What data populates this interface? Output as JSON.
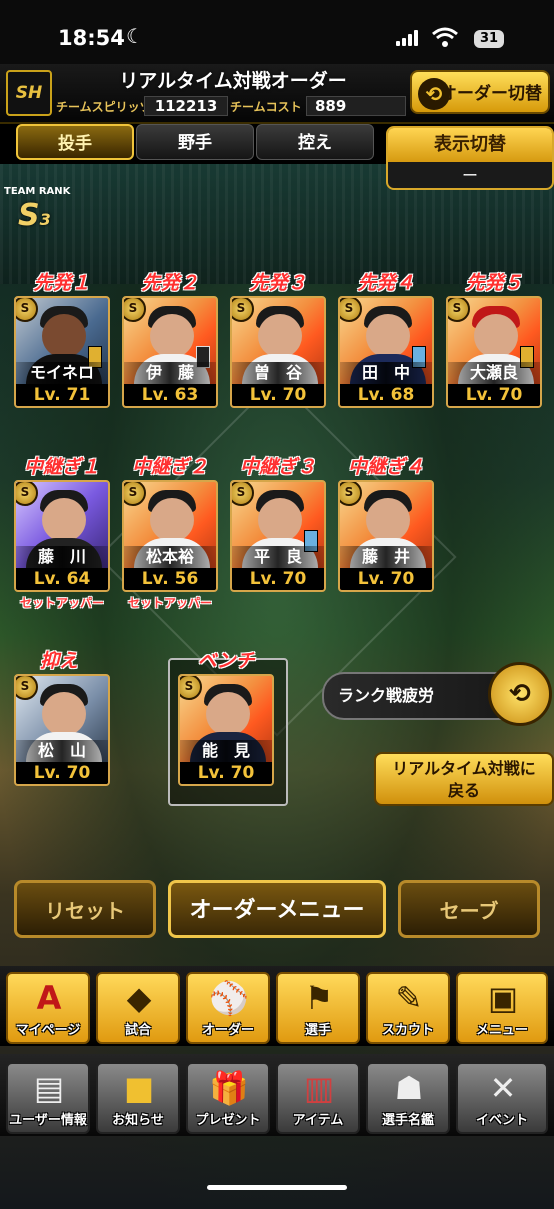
{
  "status": {
    "time": "18:54",
    "moon": "☾",
    "battery": "31"
  },
  "header": {
    "logo": "SH",
    "title": "リアルタイム対戦オーダー",
    "spirits_label": "チームスピリッツ",
    "spirits_value": "112213",
    "cost_label": "チームコスト",
    "cost_value": "889",
    "order_switch": "オーダー切替"
  },
  "tabs": [
    {
      "label": "投手",
      "active": true
    },
    {
      "label": "野手",
      "active": false
    },
    {
      "label": "控え",
      "active": false
    }
  ],
  "display_switch": {
    "label": "表示切替",
    "value": "ー"
  },
  "team_rank": {
    "label": "TEAM RANK",
    "rank": "S",
    "sub": "3"
  },
  "starters": [
    {
      "pos": "先発１",
      "name": "モイネロ",
      "lv": "Lv. 71"
    },
    {
      "pos": "先発２",
      "name": "伊　藤",
      "lv": "Lv. 63"
    },
    {
      "pos": "先発３",
      "name": "曽　谷",
      "lv": "Lv. 70"
    },
    {
      "pos": "先発４",
      "name": "田　中",
      "lv": "Lv. 68"
    },
    {
      "pos": "先発５",
      "name": "大瀬良",
      "lv": "Lv. 70"
    }
  ],
  "relievers": [
    {
      "pos": "中継ぎ１",
      "name": "藤　川",
      "lv": "Lv. 64",
      "role": "セットアッパー"
    },
    {
      "pos": "中継ぎ２",
      "name": "松本裕",
      "lv": "Lv. 56",
      "role": "セットアッパー"
    },
    {
      "pos": "中継ぎ３",
      "name": "平　良",
      "lv": "Lv. 70",
      "role": ""
    },
    {
      "pos": "中継ぎ４",
      "name": "藤　井",
      "lv": "Lv. 70",
      "role": ""
    }
  ],
  "closer": {
    "pos": "抑え",
    "name": "松　山",
    "lv": "Lv. 70"
  },
  "bench": {
    "pos": "ベンチ",
    "name": "能　見",
    "lv": "Lv. 70"
  },
  "s_badge": "S",
  "fatigue_label": "ランク戦疲労",
  "back_button": {
    "line1": "リアルタイム対戦に",
    "line2": "戻る"
  },
  "actions": {
    "reset": "リセット",
    "order_menu": "オーダーメニュー",
    "save": "セーブ"
  },
  "nav_main": [
    {
      "label": "マイページ",
      "icon": "A"
    },
    {
      "label": "試合",
      "icon": "◆"
    },
    {
      "label": "オーダー",
      "icon": "⚾"
    },
    {
      "label": "選手",
      "icon": "⚑"
    },
    {
      "label": "スカウト",
      "icon": "✎"
    },
    {
      "label": "メニュー",
      "icon": "▣"
    }
  ],
  "nav_sub": [
    {
      "label": "ユーザー情報",
      "icon": "▤"
    },
    {
      "label": "お知らせ",
      "icon": "■"
    },
    {
      "label": "プレゼント",
      "icon": "🎁"
    },
    {
      "label": "アイテム",
      "icon": "▥"
    },
    {
      "label": "選手名鑑",
      "icon": "☗"
    },
    {
      "label": "イベント",
      "icon": "✕"
    }
  ]
}
